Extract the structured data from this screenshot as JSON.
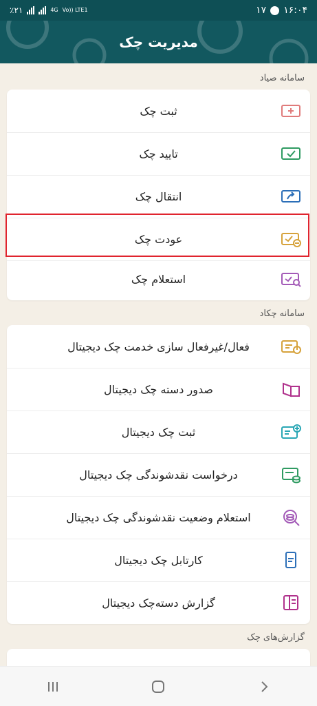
{
  "status_bar": {
    "left_battery": "٪۲۱",
    "left_network": "4G",
    "left_lte": "Vo)) LTE1",
    "right_notif_count": "۱۷",
    "right_time": "۱۶:۰۴"
  },
  "app_bar": {
    "title": "مدیریت چک"
  },
  "sections": [
    {
      "title": "سامانه صیاد",
      "items": [
        {
          "label": "ثبت چک",
          "icon": "cheque-add-icon",
          "color": "#e07b7b"
        },
        {
          "label": "تایید چک",
          "icon": "cheque-approve-icon",
          "color": "#2f9b62"
        },
        {
          "label": "انتقال چک",
          "icon": "cheque-transfer-icon",
          "color": "#2c6fb8"
        },
        {
          "label": "عودت چک",
          "icon": "cheque-return-icon",
          "color": "#d6a23b"
        },
        {
          "label": "استعلام چک",
          "icon": "cheque-inquiry-icon",
          "color": "#a35ab7"
        }
      ]
    },
    {
      "title": "سامانه چکاد",
      "items": [
        {
          "label": "فعال/غیرفعال سازی خدمت چک دیجیتال",
          "icon": "digital-cheque-toggle-icon",
          "color": "#d6a23b"
        },
        {
          "label": "صدور دسته چک دیجیتال",
          "icon": "chequebook-issue-icon",
          "color": "#b0318c"
        },
        {
          "label": "ثبت چک دیجیتال",
          "icon": "digital-cheque-add-icon",
          "color": "#2aa7b5"
        },
        {
          "label": "درخواست نقدشوندگی چک دیجیتال",
          "icon": "cash-request-icon",
          "color": "#2f9b62"
        },
        {
          "label": "استعلام وضعیت نقدشوندگی چک دیجیتال",
          "icon": "cash-status-icon",
          "color": "#a35ab7"
        },
        {
          "label": "کارتابل چک دیجیتال",
          "icon": "cartable-icon",
          "color": "#2c6fb8"
        },
        {
          "label": "گزارش دسته‌چک دیجیتال",
          "icon": "chequebook-report-icon",
          "color": "#b0318c"
        }
      ]
    },
    {
      "title": "گزارش‌های چک",
      "items": []
    }
  ],
  "nav_bar": {
    "recent_icon": "recent-apps-icon",
    "home_icon": "home-icon",
    "back_icon": "back-icon"
  }
}
